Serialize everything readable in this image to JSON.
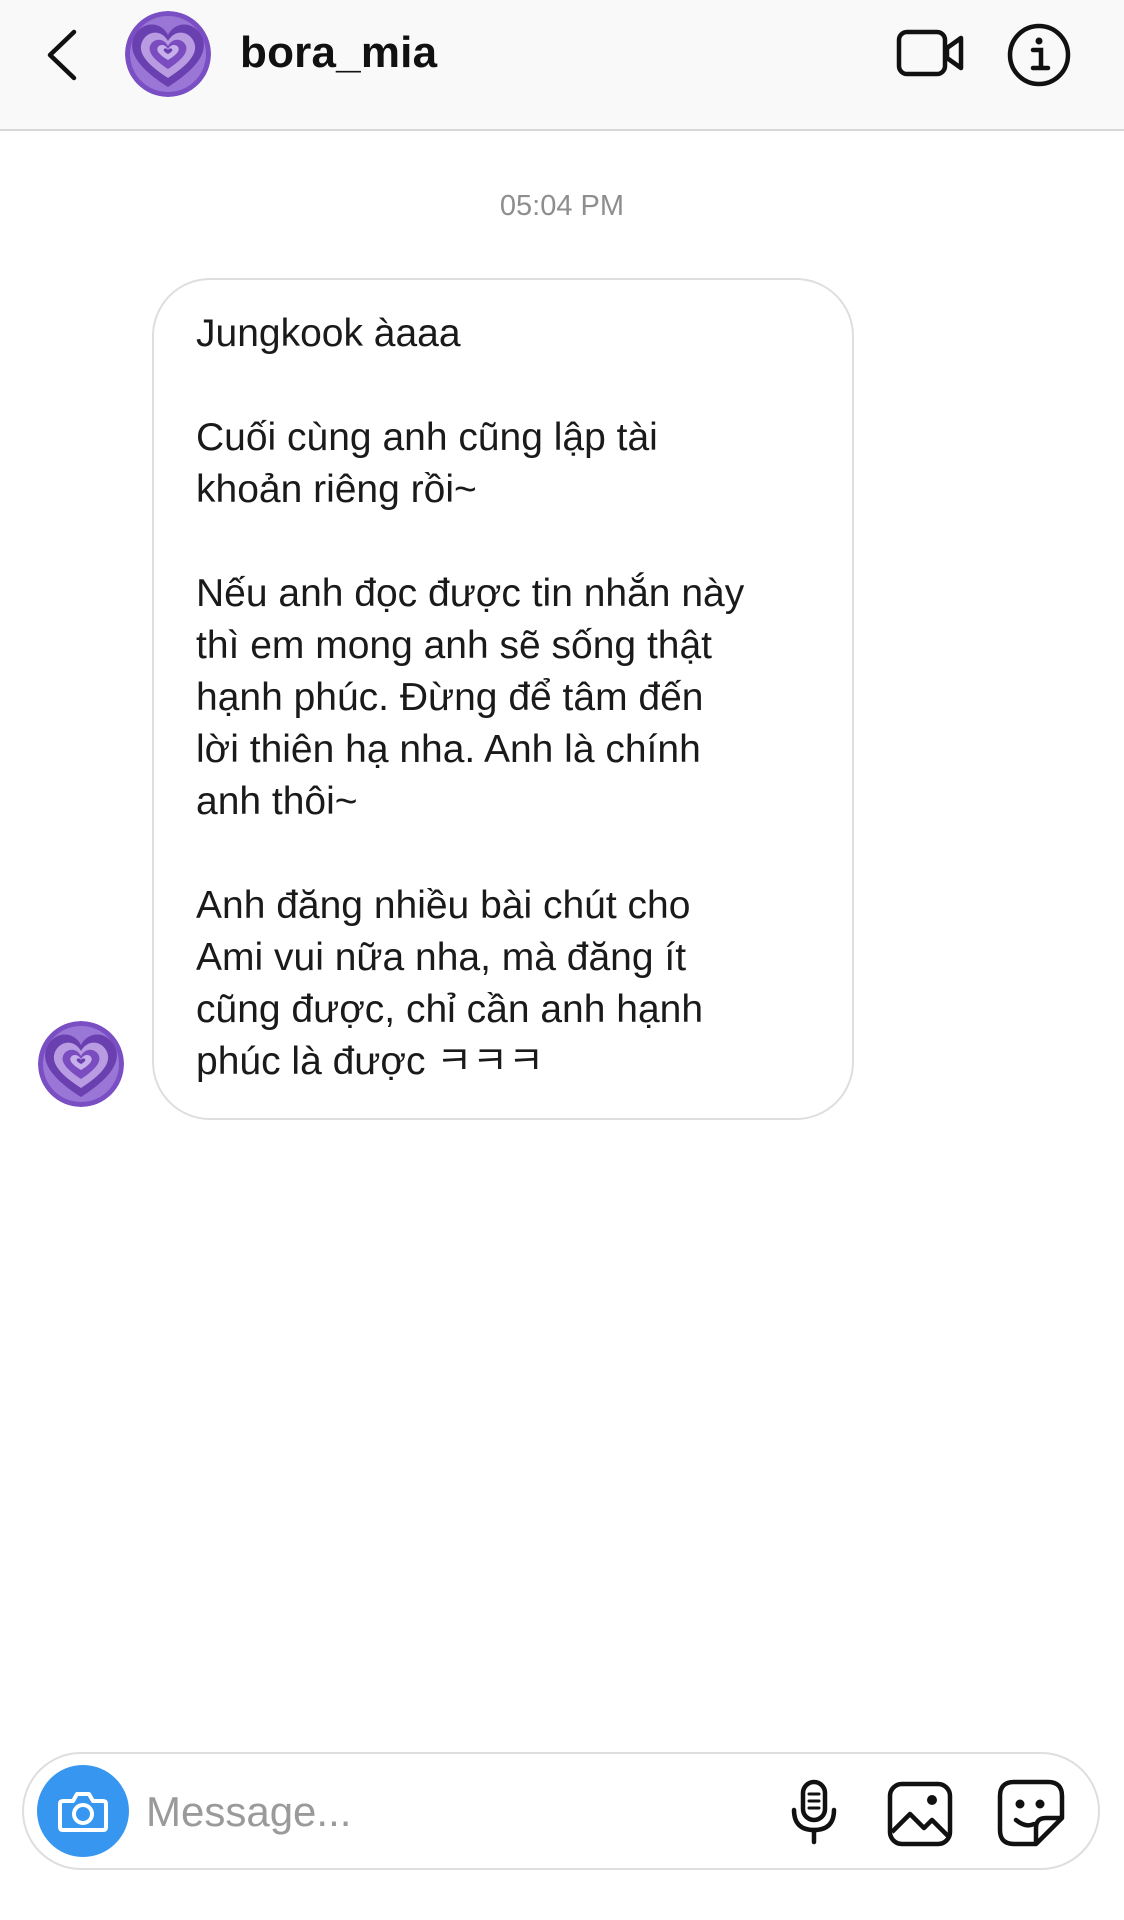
{
  "header": {
    "username": "bora_mia",
    "avatar_icon": "purple-heart-avatar-icon",
    "back_icon": "chevron-left-icon",
    "video_icon": "video-camera-icon",
    "info_icon": "info-icon"
  },
  "conversation": {
    "timestamp": "05:04 PM",
    "messages": [
      {
        "text": "Jungkook àaaa\n\nCuối cùng anh cũng lập tài\nkhoản riêng rồi~\n\nNếu anh đọc được tin nhắn này\nthì em mong anh sẽ sống thật\nhạnh phúc. Đừng để tâm đến\nlời thiên hạ nha. Anh là chính\nanh thôi~\n\nAnh đăng nhiều bài chút cho\nAmi vui nữa nha, mà đăng ít\ncũng được, chỉ cần anh hạnh\nphúc là được ㅋㅋㅋ"
      }
    ]
  },
  "composer": {
    "placeholder": "Message...",
    "camera_icon": "camera-icon",
    "mic_icon": "microphone-icon",
    "gallery_icon": "gallery-icon",
    "sticker_icon": "sticker-icon"
  },
  "colors": {
    "accent_blue": "#3797f0",
    "avatar_purple_dark": "#6a3fb0",
    "avatar_purple_light": "#b89be0",
    "timestamp_gray": "#8e8e8e",
    "border_gray": "#dedede"
  }
}
